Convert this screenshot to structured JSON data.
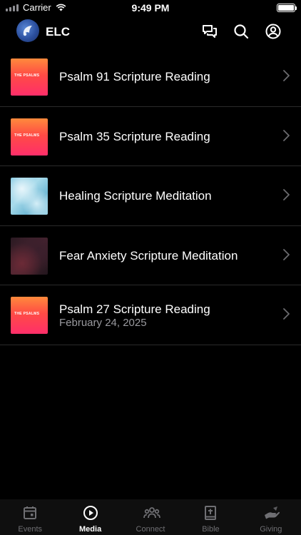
{
  "status_bar": {
    "carrier": "Carrier",
    "time": "9:49 PM"
  },
  "header": {
    "app_title": "ELC",
    "icons": [
      "chat-bubbles-icon",
      "search-icon",
      "profile-icon"
    ]
  },
  "media_items": [
    {
      "title": "Psalm 91 Scripture Reading",
      "thumbnail": "psalms",
      "thumbnail_text": "THE PSALMS"
    },
    {
      "title": "Psalm 35 Scripture Reading",
      "thumbnail": "psalms",
      "thumbnail_text": "THE PSALMS"
    },
    {
      "title": "Healing Scripture Meditation",
      "thumbnail": "sky"
    },
    {
      "title": "Fear Anxiety Scripture Meditation",
      "thumbnail": "dark"
    },
    {
      "title": "Psalm 27 Scripture Reading",
      "date": "February 24, 2025",
      "thumbnail": "psalms",
      "thumbnail_text": "THE PSALMS"
    }
  ],
  "tab_bar": {
    "tabs": [
      {
        "label": "Events",
        "icon": "calendar-icon",
        "active": false
      },
      {
        "label": "Media",
        "icon": "play-circle-icon",
        "active": true
      },
      {
        "label": "Connect",
        "icon": "people-icon",
        "active": false
      },
      {
        "label": "Bible",
        "icon": "bible-icon",
        "active": false
      },
      {
        "label": "Giving",
        "icon": "giving-hand-icon",
        "active": false
      }
    ]
  },
  "colors": {
    "background": "#000000",
    "divider": "#2a2a2a",
    "secondary_text": "#9a9a9f",
    "inactive_tab": "#6f6f73",
    "active_tab": "#ffffff"
  }
}
